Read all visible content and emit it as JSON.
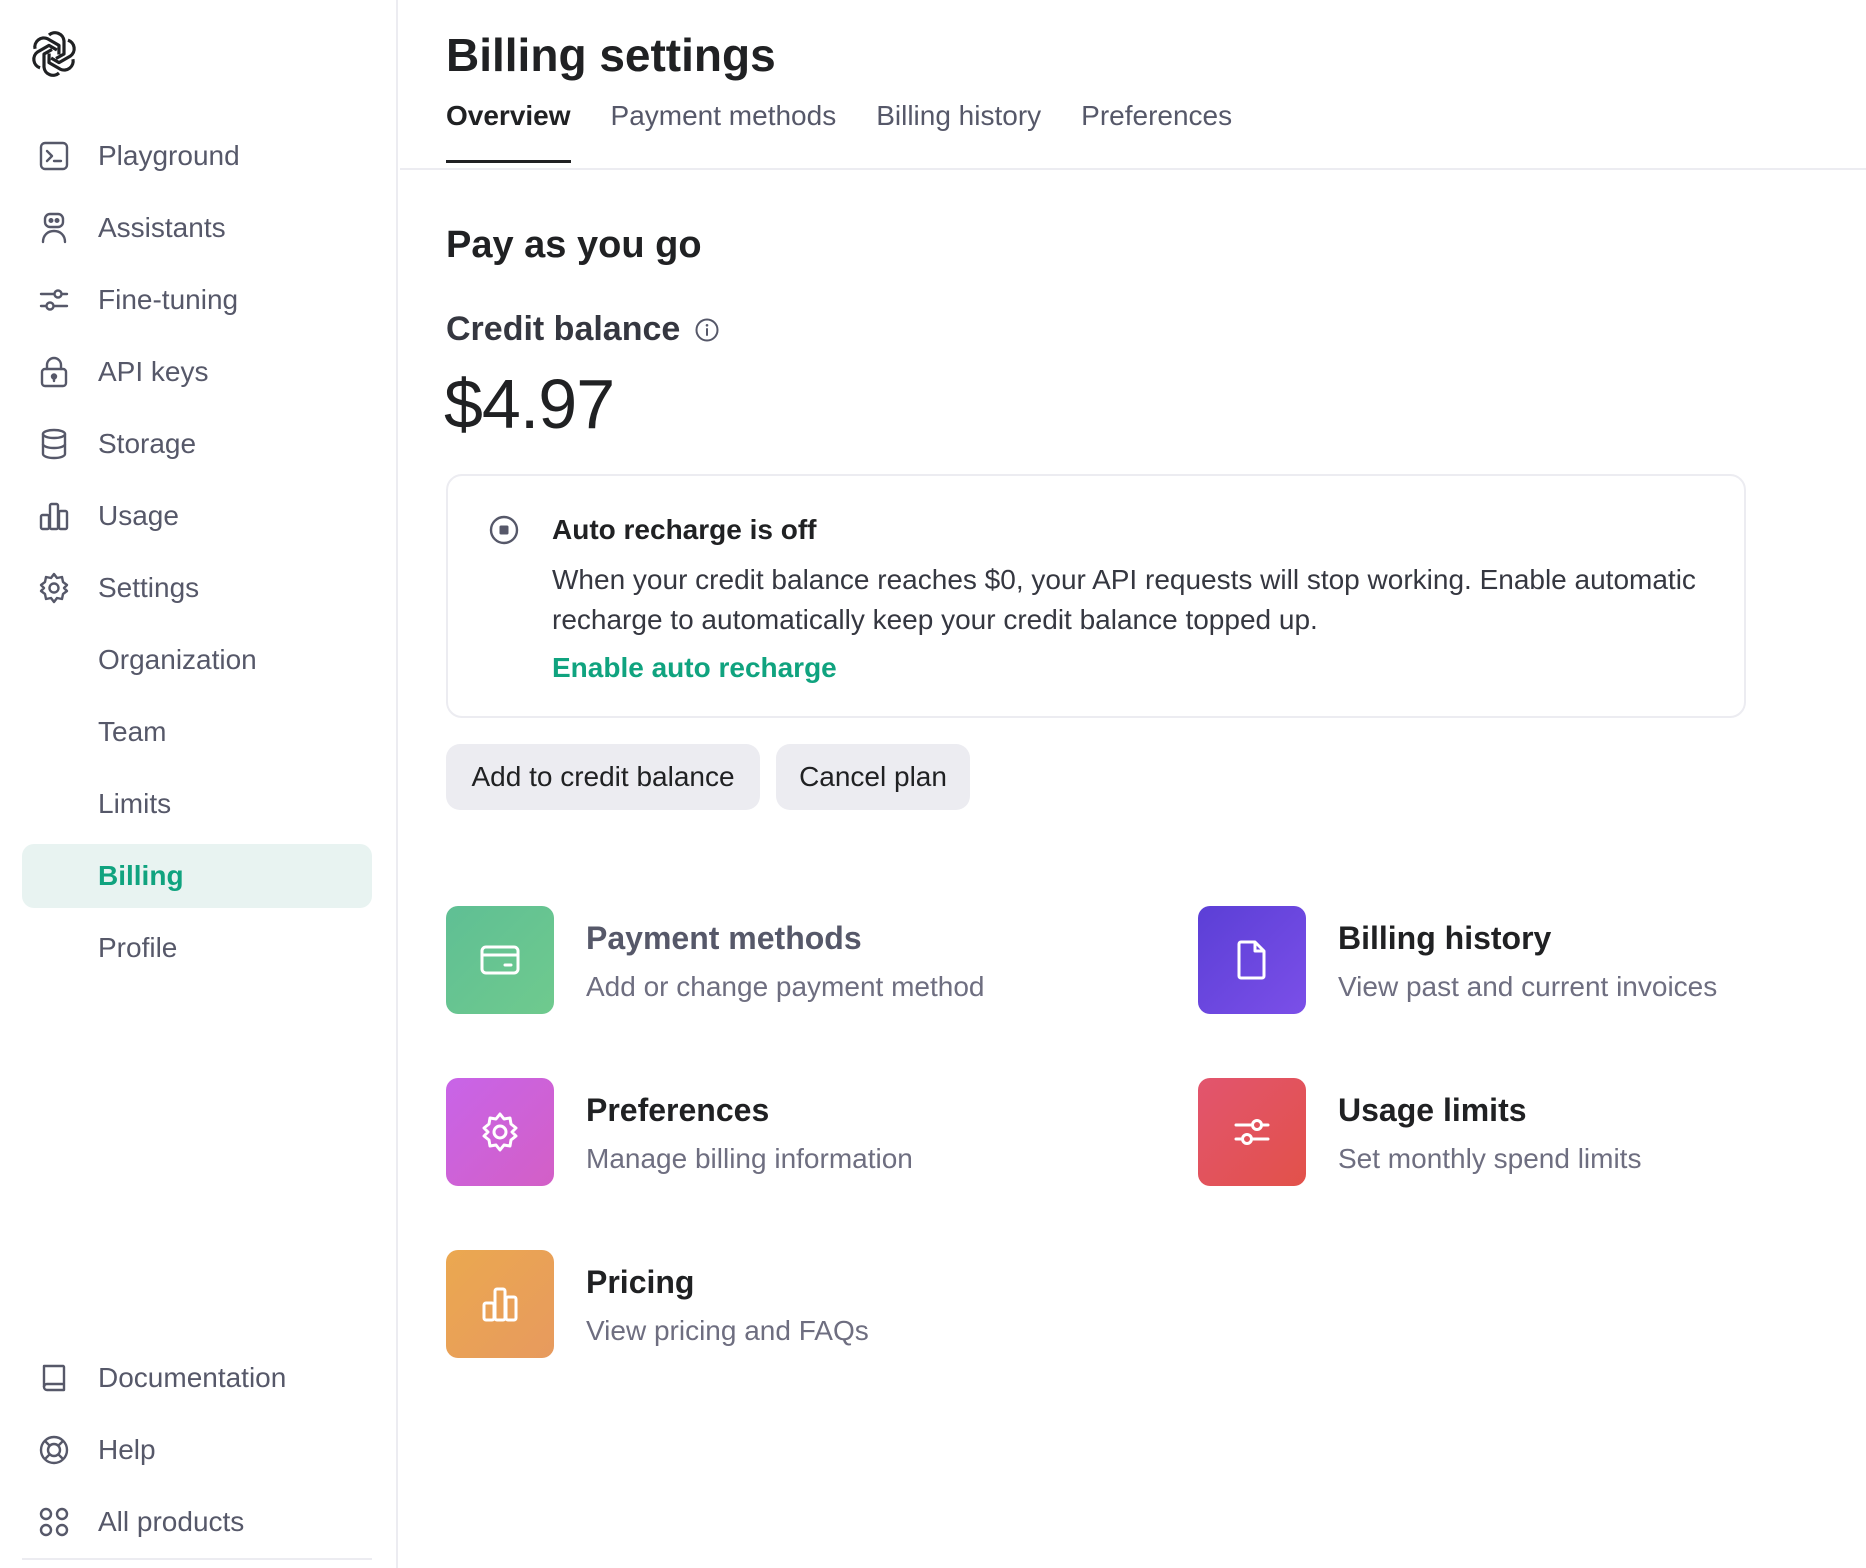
{
  "sidebar": {
    "nav": [
      {
        "label": "Playground",
        "icon": "terminal-icon"
      },
      {
        "label": "Assistants",
        "icon": "robot-icon"
      },
      {
        "label": "Fine-tuning",
        "icon": "sliders-icon"
      },
      {
        "label": "API keys",
        "icon": "lock-icon"
      },
      {
        "label": "Storage",
        "icon": "database-icon"
      },
      {
        "label": "Usage",
        "icon": "bar-chart-icon"
      },
      {
        "label": "Settings",
        "icon": "gear-icon"
      }
    ],
    "settings_sub": [
      "Organization",
      "Team",
      "Limits",
      "Billing",
      "Profile"
    ],
    "active_item": "Billing",
    "bottom": [
      {
        "label": "Documentation",
        "icon": "book-icon"
      },
      {
        "label": "Help",
        "icon": "lifebuoy-icon"
      },
      {
        "label": "All products",
        "icon": "grid-icon"
      }
    ]
  },
  "page": {
    "title": "Billing settings",
    "tabs": [
      "Overview",
      "Payment methods",
      "Billing history",
      "Preferences"
    ],
    "active_tab": "Overview"
  },
  "plan": {
    "title": "Pay as you go",
    "credit_label": "Credit balance",
    "credit_amount": "$4.97"
  },
  "recharge": {
    "title": "Auto recharge is off",
    "text": "When your credit balance reaches $0, your API requests will stop working. Enable automatic recharge to automatically keep your credit balance topped up.",
    "link": "Enable auto recharge"
  },
  "actions": {
    "add_credit": "Add to credit balance",
    "cancel_plan": "Cancel plan"
  },
  "tiles": [
    {
      "title": "Payment methods",
      "desc": "Add or change payment method",
      "icon": "credit-card-icon"
    },
    {
      "title": "Billing history",
      "desc": "View past and current invoices",
      "icon": "document-icon"
    },
    {
      "title": "Preferences",
      "desc": "Manage billing information",
      "icon": "gear-icon"
    },
    {
      "title": "Usage limits",
      "desc": "Set monthly spend limits",
      "icon": "sliders-icon"
    },
    {
      "title": "Pricing",
      "desc": "View pricing and FAQs",
      "icon": "bar-chart-icon"
    }
  ],
  "colors": {
    "accent": "#10a37f",
    "active_bg": "#e8f3f1",
    "tile_payment": [
      "#5fbf94",
      "#6fca8e"
    ],
    "tile_history": [
      "#5b3fd6",
      "#7b4fe8"
    ],
    "tile_preferences": [
      "#c864e8",
      "#d35fc6"
    ],
    "tile_limits": [
      "#e2556e",
      "#e2514a"
    ],
    "tile_pricing": [
      "#eba850",
      "#e79a5e"
    ]
  }
}
